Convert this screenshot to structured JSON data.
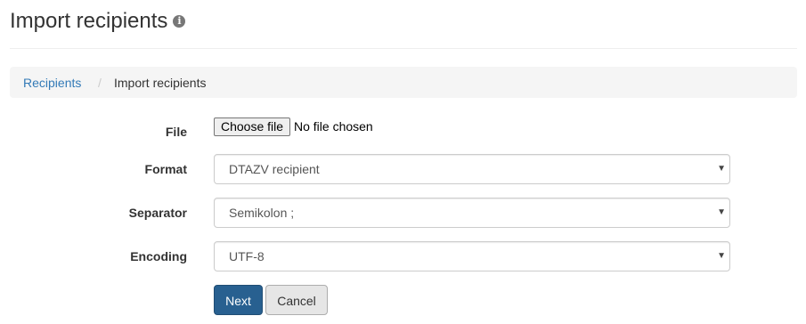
{
  "header": {
    "title": "Import recipients",
    "info_icon": "info-circle-icon"
  },
  "breadcrumb": {
    "parent": "Recipients",
    "separator": "/",
    "current": "Import recipients"
  },
  "form": {
    "file": {
      "label": "File",
      "button": "Choose file",
      "status": "No file chosen"
    },
    "format": {
      "label": "Format",
      "value": "DTAZV recipient"
    },
    "separator": {
      "label": "Separator",
      "value": "Semikolon ;"
    },
    "encoding": {
      "label": "Encoding",
      "value": "UTF-8"
    }
  },
  "actions": {
    "next": "Next",
    "cancel": "Cancel"
  },
  "colors": {
    "link": "#337ab7",
    "primary_button": "#286090",
    "breadcrumb_bg": "#f5f5f5"
  }
}
